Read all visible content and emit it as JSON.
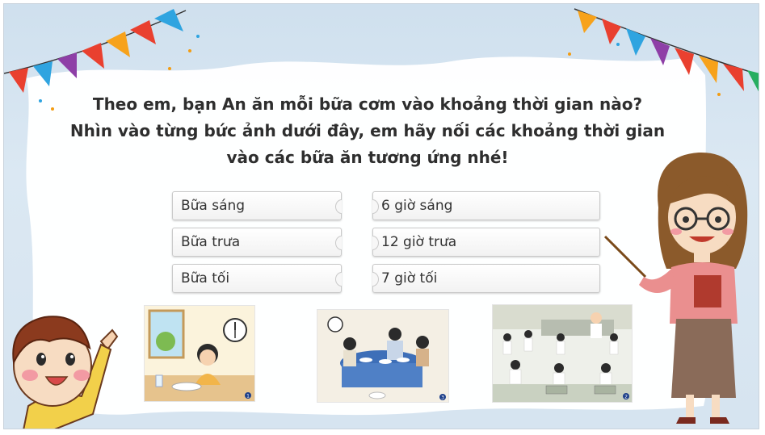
{
  "slide": {
    "question": {
      "line1": "Theo em, bạn An ăn mỗi bữa cơm vào khoảng thời gian nào?",
      "line2": "Nhìn vào từng bức ảnh dưới đây, em hãy nối các khoảng thời gian",
      "line3": "vào các bữa ăn tương ứng nhé!"
    },
    "left_pieces": [
      "Bữa sáng",
      "Bữa trưa",
      "Bữa tối"
    ],
    "right_pieces": [
      "6 giờ sáng",
      "12 giờ trưa",
      "7 giờ tối"
    ],
    "pictures": [
      {
        "number": "1",
        "icon": "breakfast-scene"
      },
      {
        "number": "3",
        "icon": "family-dinner-scene"
      },
      {
        "number": "2",
        "icon": "school-lunch-scene"
      }
    ],
    "colors": {
      "background": "#d6e4f0",
      "text": "#2e2e2e",
      "bunting": [
        "#e9402f",
        "#f7a21b",
        "#2fa4e0",
        "#8e3fa7",
        "#27ae60"
      ]
    }
  }
}
